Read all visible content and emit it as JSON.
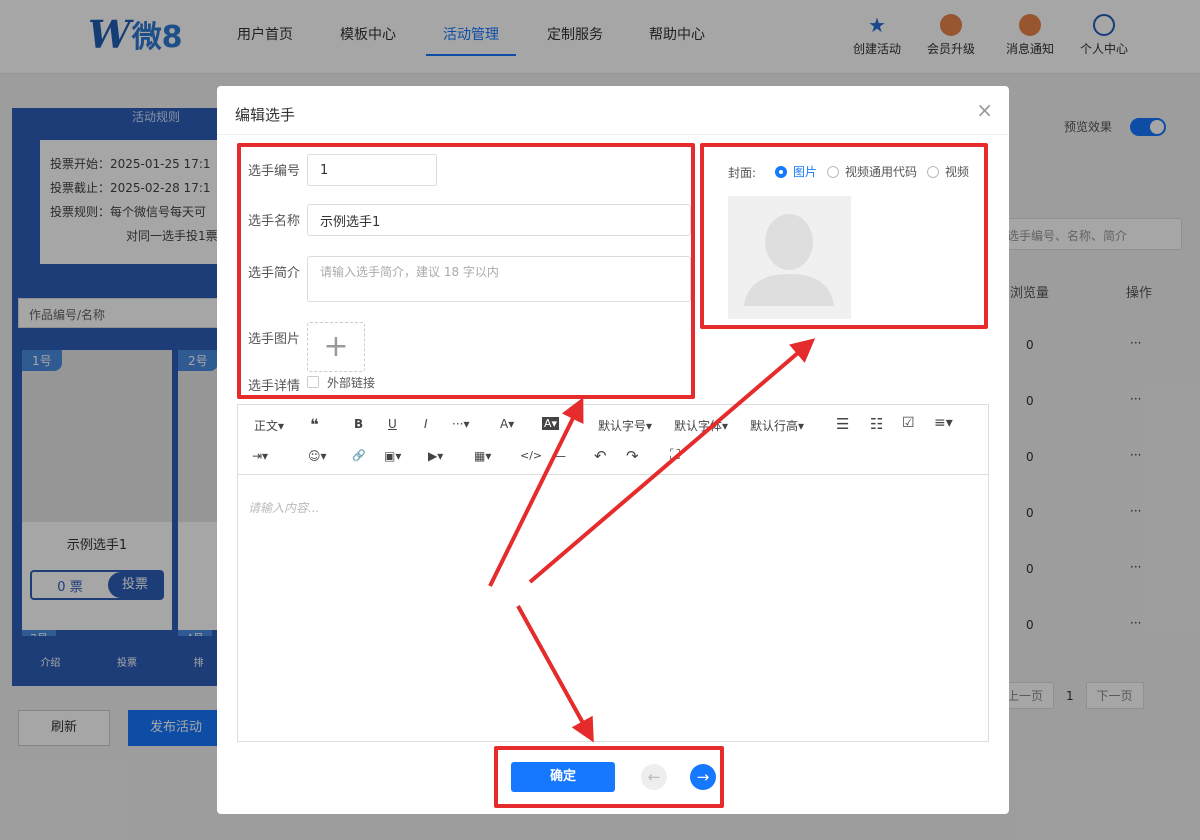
{
  "header": {
    "logo_mark": "W",
    "logo_text": "微8",
    "nav": [
      "用户首页",
      "模板中心",
      "活动管理",
      "定制服务",
      "帮助中心"
    ],
    "active_nav": "活动管理",
    "tools": [
      {
        "label": "创建活动",
        "icon": "star-icon"
      },
      {
        "label": "会员升级",
        "icon": "crown-icon"
      },
      {
        "label": "消息通知",
        "icon": "bell-icon"
      },
      {
        "label": "个人中心",
        "icon": "user-icon"
      }
    ]
  },
  "background": {
    "rules_title": "活动规则",
    "vote_start": "投票开始：2025-01-25 17:1",
    "vote_end": "投票截止：2025-02-28 17:1",
    "vote_rule_1": "投票规则：每个微信号每天可",
    "vote_rule_2": "对同一选手投1票",
    "search_placeholder": "作品编号/名称",
    "cards": [
      {
        "num": "1号",
        "name": "示例选手1",
        "votes": "0 票",
        "vote_btn": "投票"
      },
      {
        "num": "2号"
      }
    ],
    "card3_num": "3号",
    "card4_num": "4号",
    "tabs": [
      "介绍",
      "投票",
      "排"
    ],
    "refresh": "刷新",
    "publish": "发布活动",
    "preview_label": "预览效果",
    "preview_on": true,
    "right_search_placeholder": "选手编号、名称、简介",
    "col_views": "浏览量",
    "col_ops": "操作",
    "rows": [
      "0",
      "0",
      "0",
      "0",
      "0",
      "0"
    ],
    "op_dots": "···",
    "pager_prev": "上一页",
    "pager_page": "1",
    "pager_next": "下一页"
  },
  "modal": {
    "title": "编辑选手",
    "close": "×",
    "fields": {
      "number_label": "选手编号",
      "number_value": "1",
      "name_label": "选手名称",
      "name_value": "示例选手1",
      "intro_label": "选手简介",
      "intro_placeholder": "请输入选手简介，建议 18 字以内",
      "image_label": "选手图片",
      "upload_plus": "+",
      "detail_label": "选手详情",
      "external_link": "外部链接"
    },
    "cover": {
      "label": "封面:",
      "options": [
        "图片",
        "视频通用代码",
        "视频"
      ],
      "selected": "图片"
    },
    "editor": {
      "toolbar_row1": [
        "正文▾",
        "❝",
        "B",
        "U",
        "I",
        "···▾",
        "A▾",
        "A▾",
        "默认字号▾",
        "默认字体▾",
        "默认行高▾",
        "☰",
        "☷",
        "☑",
        "≡▾"
      ],
      "toolbar_row2": [
        "⇥▾",
        "☺▾",
        "🔗",
        "▣▾",
        "▶▾",
        "▦▾",
        "</>",
        "—",
        "↶",
        "↷",
        "⛶"
      ],
      "placeholder": "请输入内容..."
    },
    "confirm": "确定",
    "prev_arrow": "←",
    "next_arrow": "→"
  },
  "colors": {
    "accent": "#1677ff",
    "annotation": "#e52b2b",
    "panel": "#2d5fb8"
  }
}
